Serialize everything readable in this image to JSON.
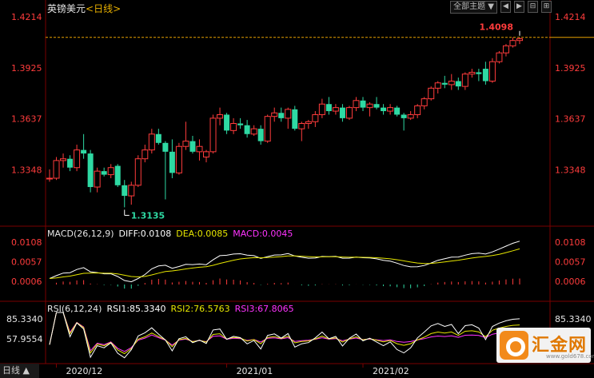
{
  "header": {
    "symbol": "英镑美元",
    "period": "<日线>",
    "topic_button": "全部主题",
    "dropdown_icon": "triangle-down-icon",
    "nav_buttons": [
      "◀",
      "▶",
      "⊟",
      "⊞"
    ]
  },
  "chart_data": {
    "type": "candlestick",
    "period": "daily",
    "price_axis_ticks": [
      "1.4214",
      "1.3925",
      "1.3637",
      "1.3348"
    ],
    "high_label": "1.4098",
    "low_label": "1.3135",
    "last_price_line": 1.4098,
    "date_ticks": [
      "2020/12",
      "2021/01",
      "2021/02"
    ],
    "colors": {
      "up": "#ff3c3c",
      "down": "#2ed9a3",
      "grid": "#7a0000"
    },
    "candles": [
      [
        1.33,
        1.335,
        1.328,
        1.33
      ],
      [
        1.33,
        1.342,
        1.329,
        1.34
      ],
      [
        1.34,
        1.344,
        1.336,
        1.341
      ],
      [
        1.341,
        1.343,
        1.334,
        1.336
      ],
      [
        1.336,
        1.349,
        1.334,
        1.346
      ],
      [
        1.346,
        1.355,
        1.341,
        1.344
      ],
      [
        1.344,
        1.346,
        1.322,
        1.325
      ],
      [
        1.325,
        1.336,
        1.322,
        1.334
      ],
      [
        1.334,
        1.336,
        1.331,
        1.332
      ],
      [
        1.332,
        1.338,
        1.33,
        1.336
      ],
      [
        1.337,
        1.338,
        1.325,
        1.326
      ],
      [
        1.326,
        1.329,
        1.3135,
        1.32
      ],
      [
        1.32,
        1.328,
        1.315,
        1.326
      ],
      [
        1.326,
        1.343,
        1.325,
        1.341
      ],
      [
        1.341,
        1.349,
        1.339,
        1.346
      ],
      [
        1.346,
        1.358,
        1.344,
        1.355
      ],
      [
        1.355,
        1.358,
        1.349,
        1.35
      ],
      [
        1.35,
        1.351,
        1.318,
        1.345
      ],
      [
        1.345,
        1.352,
        1.33,
        1.333
      ],
      [
        1.333,
        1.35,
        1.332,
        1.348
      ],
      [
        1.348,
        1.362,
        1.346,
        1.351
      ],
      [
        1.351,
        1.354,
        1.344,
        1.345
      ],
      [
        1.345,
        1.352,
        1.34,
        1.348
      ],
      [
        1.342,
        1.346,
        1.339,
        1.345
      ],
      [
        1.345,
        1.366,
        1.344,
        1.364
      ],
      [
        1.364,
        1.37,
        1.36,
        1.366
      ],
      [
        1.366,
        1.367,
        1.355,
        1.357
      ],
      [
        1.357,
        1.364,
        1.355,
        1.361
      ],
      [
        1.361,
        1.364,
        1.358,
        1.36
      ],
      [
        1.36,
        1.363,
        1.353,
        1.355
      ],
      [
        1.355,
        1.36,
        1.354,
        1.358
      ],
      [
        1.358,
        1.36,
        1.349,
        1.351
      ],
      [
        1.351,
        1.366,
        1.35,
        1.365
      ],
      [
        1.365,
        1.37,
        1.362,
        1.367
      ],
      [
        1.367,
        1.37,
        1.362,
        1.364
      ],
      [
        1.364,
        1.37,
        1.358,
        1.369
      ],
      [
        1.369,
        1.371,
        1.357,
        1.358
      ],
      [
        1.358,
        1.362,
        1.351,
        1.361
      ],
      [
        1.361,
        1.363,
        1.358,
        1.362
      ],
      [
        1.362,
        1.368,
        1.359,
        1.366
      ],
      [
        1.366,
        1.375,
        1.364,
        1.372
      ],
      [
        1.372,
        1.376,
        1.366,
        1.368
      ],
      [
        1.368,
        1.372,
        1.366,
        1.37
      ],
      [
        1.37,
        1.372,
        1.362,
        1.364
      ],
      [
        1.364,
        1.371,
        1.363,
        1.37
      ],
      [
        1.37,
        1.376,
        1.368,
        1.374
      ],
      [
        1.374,
        1.376,
        1.368,
        1.37
      ],
      [
        1.37,
        1.373,
        1.365,
        1.372
      ],
      [
        1.372,
        1.376,
        1.369,
        1.37
      ],
      [
        1.37,
        1.372,
        1.366,
        1.368
      ],
      [
        1.368,
        1.372,
        1.366,
        1.37
      ],
      [
        1.37,
        1.371,
        1.365,
        1.366
      ],
      [
        1.366,
        1.367,
        1.357,
        1.364
      ],
      [
        1.364,
        1.368,
        1.363,
        1.366
      ],
      [
        1.366,
        1.372,
        1.364,
        1.371
      ],
      [
        1.371,
        1.376,
        1.369,
        1.375
      ],
      [
        1.375,
        1.382,
        1.374,
        1.381
      ],
      [
        1.381,
        1.385,
        1.378,
        1.384
      ],
      [
        1.384,
        1.388,
        1.381,
        1.383
      ],
      [
        1.383,
        1.389,
        1.38,
        1.385
      ],
      [
        1.385,
        1.387,
        1.38,
        1.382
      ],
      [
        1.382,
        1.39,
        1.38,
        1.389
      ],
      [
        1.389,
        1.392,
        1.387,
        1.39
      ],
      [
        1.39,
        1.392,
        1.385,
        1.389
      ],
      [
        1.392,
        1.396,
        1.383,
        1.385
      ],
      [
        1.385,
        1.398,
        1.384,
        1.396
      ],
      [
        1.396,
        1.402,
        1.395,
        1.401
      ],
      [
        1.401,
        1.406,
        1.399,
        1.405
      ],
      [
        1.405,
        1.4098,
        1.404,
        1.408
      ],
      [
        1.408,
        1.4098,
        1.406,
        1.409
      ]
    ],
    "macd": {
      "header": "MACD(26,12,9)",
      "diff_label": "DIFF:0.0108",
      "dea_label": "DEA:0.0085",
      "macd_label": "MACD:0.0045",
      "axis_ticks": [
        "0.0108",
        "0.0057",
        "0.0006"
      ],
      "axis_values": [
        0.0108,
        0.0057,
        0.0006
      ],
      "colors": {
        "diff": "#ffffff",
        "dea": "#e6e600",
        "label_diff": "#ffffff",
        "label_dea": "#e6e600",
        "label_macd": "#ff33ff"
      }
    },
    "rsi": {
      "header": "RSI(6,12,24)",
      "rsi1_label": "RSI1:85.3340",
      "rsi2_label": "RSI2:76.5763",
      "rsi3_label": "RSI3:67.8065",
      "axis_ticks": [
        "85.3340",
        "57.9554",
        "30.5764"
      ],
      "axis_values": [
        85.334,
        57.9554,
        30.5764
      ],
      "colors": {
        "rsi1": "#ffffff",
        "rsi2": "#e6e600",
        "rsi3": "#ff33ff"
      }
    }
  },
  "logo": {
    "text": "汇金网",
    "url": "www.gold678.com"
  },
  "footer": {
    "period_label": "日线",
    "arrow": "▲"
  }
}
